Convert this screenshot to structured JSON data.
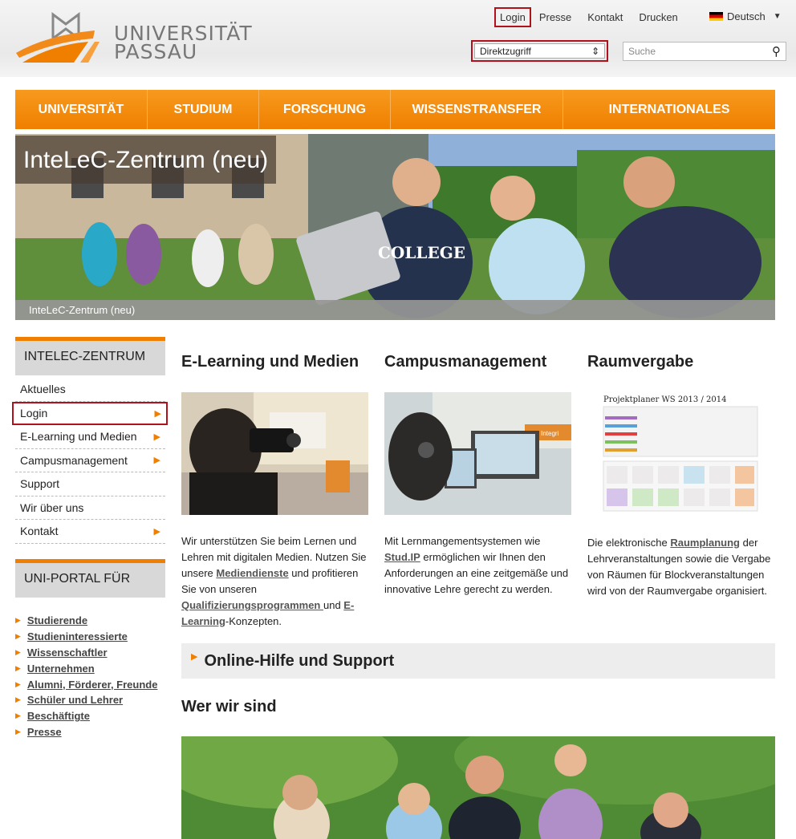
{
  "header": {
    "logo_line1": "UNIVERSITÄT",
    "logo_line2": "PASSAU",
    "links": {
      "login": "Login",
      "presse": "Presse",
      "kontakt": "Kontakt",
      "drucken": "Drucken"
    },
    "language": "Deutsch",
    "direktzugriff": "Direktzugriff",
    "search_placeholder": "Suche"
  },
  "nav": [
    "Universität",
    "Studium",
    "Forschung",
    "Wissenstransfer",
    "Internationales"
  ],
  "hero": {
    "title": "InteLeC-Zentrum (neu)",
    "caption": "InteLeC-Zentrum (neu)",
    "shirt_text": "COLLEGE"
  },
  "sidebar": {
    "heading": "INTELEC-ZENTRUM",
    "items": [
      "Aktuelles",
      "Login",
      "E-Learning und Medien",
      "Campusmanagement",
      "Support",
      "Wir über uns",
      "Kontakt"
    ],
    "portal_heading": "UNI-PORTAL FÜR",
    "portal_links": [
      "Studierende",
      "Studieninteressierte",
      "Wissenschaftler",
      "Unternehmen",
      "Alumni, Förderer, Freunde",
      "Schüler und Lehrer",
      "Beschäftigte",
      "Presse"
    ]
  },
  "columns": {
    "elearning": {
      "title": "E-Learning und Medien",
      "t1": "Wir unterstützen Sie beim Lernen und Lehren mit digitalen Medien. Nutzen Sie unsere ",
      "l1": "Mediendienste",
      "t2": " und profitieren Sie von unseren ",
      "l2": "Qualifizierungsprogrammen ",
      "t3": "und ",
      "l3": "E-Learning",
      "t4": "-Konzepten."
    },
    "campus": {
      "title": "Campusmanagement",
      "t1": "Mit Lernmangementsystemen wie ",
      "l1": "Stud.IP",
      "t2": " ermöglichen wir Ihnen den Anforderungen an eine zeitgemäße und innovative Lehre gerecht zu werden.",
      "img_label": "Der Integri"
    },
    "raum": {
      "title": "Raumvergabe",
      "img_title": "Projektplaner WS 2013 / 2014",
      "t1": "Die elektronische ",
      "l1": "Raumplanung",
      "t2": " der Lehrveranstaltungen sowie die Vergabe von Räumen für Blockveranstaltungen wird von der Raumvergabe organisiert."
    }
  },
  "help": "Online-Hilfe und Support",
  "wer_wir_sind": "Wer wir sind",
  "colors": {
    "accent": "#f07f00",
    "highlight_border": "#b0121b"
  }
}
